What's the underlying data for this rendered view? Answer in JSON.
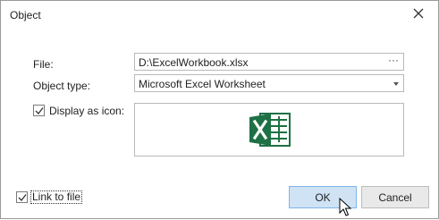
{
  "dialog": {
    "title": "Object"
  },
  "file": {
    "label": "File:",
    "value": "D:\\ExcelWorkbook.xlsx",
    "browse_label": "···"
  },
  "object_type": {
    "label": "Object type:",
    "value": "Microsoft Excel Worksheet"
  },
  "display_as_icon": {
    "label": "Display as icon:",
    "checked": true
  },
  "link_to_file": {
    "label": "Link to file",
    "checked": true
  },
  "buttons": {
    "ok_label": "OK",
    "cancel_label": "Cancel"
  },
  "colors": {
    "excel_green": "#1e7145",
    "ok_bg": "#cfe3f5",
    "ok_border": "#7eb4ea"
  },
  "icons": {
    "close": "close-icon",
    "excel": "excel-icon",
    "cursor": "mouse-pointer-icon"
  }
}
